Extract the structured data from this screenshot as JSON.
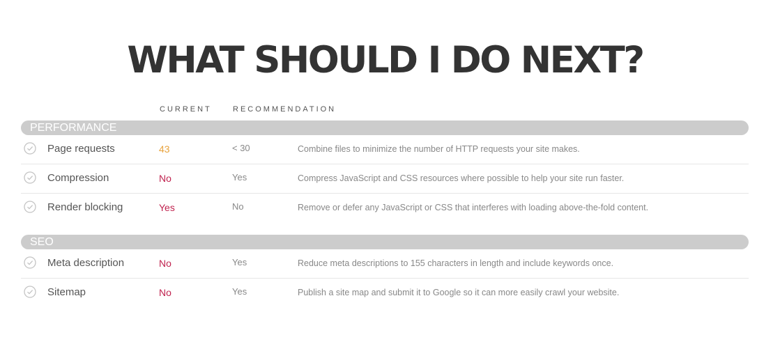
{
  "title": "WHAT SHOULD I DO NEXT?",
  "columns": {
    "current": "CURRENT",
    "recommendation": "RECOMMENDATION"
  },
  "colors": {
    "warning": "#e8a33d",
    "bad": "#c0234f",
    "section_bar": "#cccccc",
    "title": "#333333"
  },
  "sections": [
    {
      "label": "PERFORMANCE",
      "rows": [
        {
          "icon": "check-circle-icon",
          "metric": "Page requests",
          "current": "43",
          "status": "warning",
          "recommendation": "< 30",
          "advice": "Combine files to minimize the number of HTTP requests your site makes."
        },
        {
          "icon": "check-circle-icon",
          "metric": "Compression",
          "current": "No",
          "status": "bad",
          "recommendation": "Yes",
          "advice": "Compress JavaScript and CSS resources where possible to help your site run faster."
        },
        {
          "icon": "check-circle-icon",
          "metric": "Render blocking",
          "current": "Yes",
          "status": "bad",
          "recommendation": "No",
          "advice": "Remove or defer any JavaScript or CSS that interferes with loading above-the-fold content."
        }
      ]
    },
    {
      "label": "SEO",
      "rows": [
        {
          "icon": "check-circle-icon",
          "metric": "Meta description",
          "current": "No",
          "status": "bad",
          "recommendation": "Yes",
          "advice": "Reduce meta descriptions to 155 characters in length and include keywords once."
        },
        {
          "icon": "check-circle-icon",
          "metric": "Sitemap",
          "current": "No",
          "status": "bad",
          "recommendation": "Yes",
          "advice": "Publish a site map and submit it to Google so it can more easily crawl your website."
        }
      ]
    }
  ]
}
